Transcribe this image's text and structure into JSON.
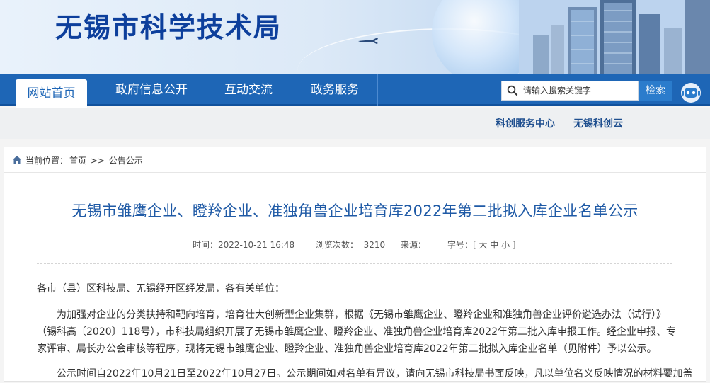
{
  "site": {
    "title": "无锡市科学技术局"
  },
  "nav": {
    "items": [
      "网站首页",
      "政府信息公开",
      "互动交流",
      "政务服务"
    ],
    "search_placeholder": "请输入搜索关键字",
    "search_button": "检索"
  },
  "sublinks": [
    "科创服务中心",
    "无锡科创云"
  ],
  "breadcrumb": {
    "label": "当前位置：",
    "home": "首页",
    "sep": ">>",
    "current": "公告公示"
  },
  "article": {
    "title": "无锡市雏鹰企业、瞪羚企业、准独角兽企业培育库2022年第二批拟入库企业名单公示",
    "meta": {
      "time": "时间：2022-10-21 16:48",
      "views": "浏览次数：  3210",
      "source": "来源：",
      "font_size": "字号：[ 大 中 小 ]"
    },
    "greeting": "各市（县）区科技局、无锡经开区经发局，各有关单位：",
    "para1_line1": "为加强对企业的分类扶持和靶向培育，培育壮大创新型企业集群，根据《无锡市雏鹰企业、瞪羚企业和准独角兽企业评价遴选办法（试行）》",
    "para1_line2": "（锡科高〔2020〕118号），市科技局组织开展了无锡市雏鹰企业、瞪羚企业、准独角兽企业培育库2022年第二批入库申报工作。经企业申报、专",
    "para1_line3": "家评审、局长办公会审核等程序，现将无锡市雏鹰企业、瞪羚企业、准独角兽企业培育库2022年第二批拟入库企业名单（见附件）予以公示。",
    "para2_line1": "公示时间自2022年10月21日至2022年10月27日。公示期间如对名单有异议，请向无锡市科技局书面反映，凡以单位名义反映情况的材料要加盖"
  }
}
